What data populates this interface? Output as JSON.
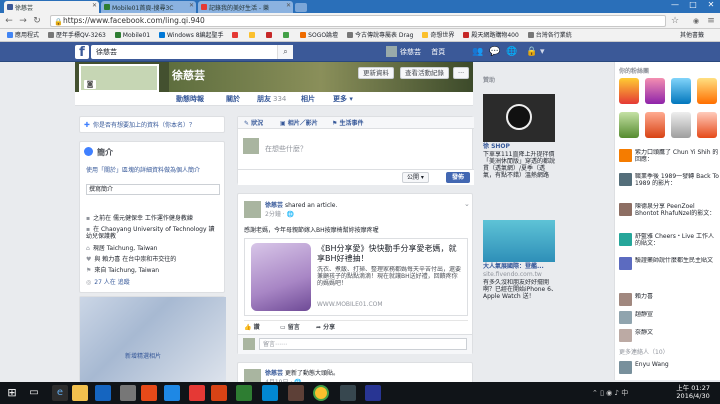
{
  "browser": {
    "tabs": [
      {
        "label": "徐慈芸",
        "active": true,
        "favicon_color": "#3b5998"
      },
      {
        "label": "Mobile01首頁-搜尋3C",
        "active": false,
        "favicon_color": "#2e7d32"
      },
      {
        "label": "記錄我的美好生活 - 樂",
        "active": false,
        "favicon_color": "#e53935"
      }
    ],
    "window_controls": [
      "—",
      "□",
      "✕"
    ],
    "url": "https://www.facebook.com/ling.qi.940",
    "bookmarks": [
      "應用程式",
      "歷年手標QV-3263",
      "Mobile01",
      "Windows 8編起聖手",
      "",
      "",
      "",
      "",
      "SOGO論壇",
      "",
      "今古傳說專屬表 Drag",
      "",
      "奇想世界",
      "殿天網路購物400",
      "",
      "台灣各行業統",
      "",
      "",
      "其他書籤"
    ]
  },
  "fb": {
    "search_value": "徐慈芸",
    "user_name": "徐慈芸",
    "home_label": "首頁",
    "profile_name": "徐慈芸",
    "cover_buttons": [
      "更新資料",
      "查看活動紀錄",
      "···"
    ],
    "timeline_nav": [
      {
        "label": "動態時報",
        "count": ""
      },
      {
        "label": "關於",
        "count": ""
      },
      {
        "label": "朋友",
        "count": "334"
      },
      {
        "label": "相片",
        "count": ""
      },
      {
        "label": "更多 ▾",
        "count": ""
      }
    ],
    "ask_card": "你是否有想要加上的資料（你本名）？",
    "about": {
      "title": "簡介",
      "prompt": "使用「關於」區塊的詳細資料做為個人簡介",
      "edit_label": "撰寫簡介",
      "items": [
        "之前在 儒元健保幸 工作運作健身教練",
        "在 Chaoyang University of Technology 讀 幼兒保護教",
        "現居 Taichung, Taiwan",
        "與 賴力喜 在台中崇和市交往的",
        "來自 Taichung, Taiwan",
        "27 人在 追蹤"
      ]
    },
    "photo_add_label": "新增精選相片",
    "composer": {
      "tabs": [
        "狀況",
        "相片／影片",
        "生活事件"
      ],
      "placeholder": "在想些什麼？",
      "privacy": "公開 ▾",
      "post_label": "發佈"
    },
    "post1": {
      "author": "徐慈芸",
      "action": "shared an article.",
      "time": "2分鐘 · 🌐",
      "text": "感謝老媽，今年母親節嫁入BH按摩椅幫妳按摩疼喔",
      "link_title": "《BH分享愛》快快動手分享愛老媽，就享BH好禮抽！",
      "link_desc": "洗衣、煮飯、打掃、整理家務都媽每天辛苦付出，還要兼顧孩子的點點滴滴！現在就讓BH送好禮，回饋疼你的媽媽吧！",
      "link_domain": "WWW.MOBILE01.COM",
      "actions": [
        "讚",
        "留言",
        "分享"
      ],
      "comment_placeholder": "留言⋯⋯"
    },
    "post2": {
      "author": "徐慈芸",
      "action": "更新了動態大頭貼。",
      "time": "4月19日 · 🌐"
    },
    "right": {
      "ads_title": "贊助",
      "ad1_name": "徐 SHOP",
      "ad1_text": "下單享111直降上升提拌價「美洲休閒版」穿透的都說貫（透氣網）/夏季（透氣，有點不錯）溫熱網路",
      "ad2_name": "大人氣展國際：登艦...",
      "ad2_domain": "site.fivendo.com.tw",
      "ad2_text": "有多久沒和朋友好好擺開啊？已經在開始iPhone 6、Apple Watch 送！"
    },
    "chat": {
      "title": "你的粉絲團",
      "rows": [
        "紫力口頭鷹了 Chun Yi Shih 的回應：",
        "職業季後 1989一發轉 Back To 1989 的影片：",
        "陳德泉分享 PeenZoel Bhontot RhafuNzel的影文：",
        "舒藍雅 Cheers・Live 工作人的貼文：",
        "驗證藥師說什麼都生民主貼文"
      ],
      "friends": [
        "賴力喜",
        "趙靜宣",
        "奈靜文"
      ],
      "more_label": "更多連絡人（10）",
      "friend_last": "Enyu Wang"
    }
  },
  "taskbar": {
    "time": "上午 01:27",
    "date": "2016/4/30"
  },
  "colors": {
    "fb_blue": "#3b5998",
    "chrome_blue": "#2a6fb9",
    "link": "#365899"
  }
}
